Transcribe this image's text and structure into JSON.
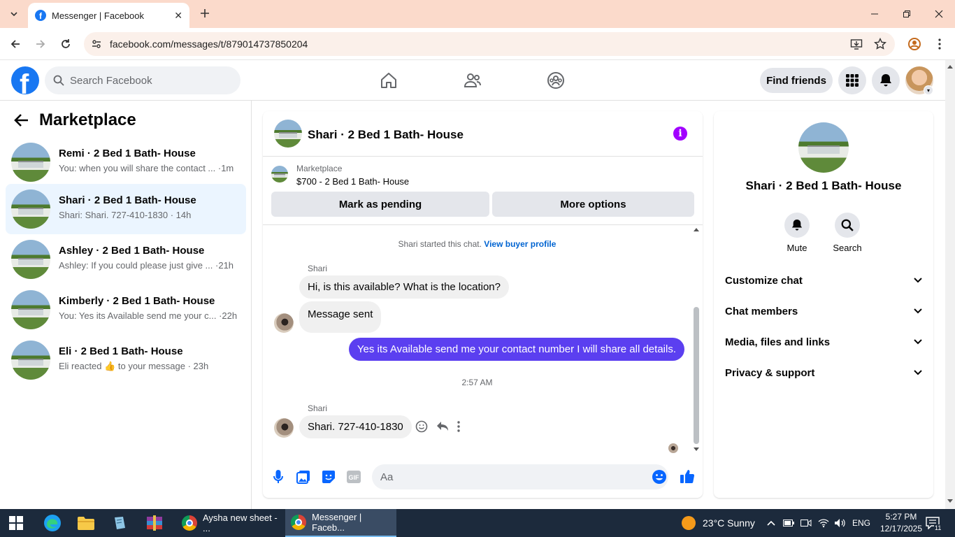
{
  "browser": {
    "tab_title": "Messenger | Facebook",
    "url": "facebook.com/messages/t/879014737850204"
  },
  "fb_nav": {
    "search_placeholder": "Search Facebook",
    "find_friends": "Find friends"
  },
  "sidebar": {
    "title": "Marketplace",
    "conversations": [
      {
        "name": "Remi · 2 Bed 1 Bath- House",
        "snippet": "You: when you will share the contact ... ·1m",
        "active": false
      },
      {
        "name": "Shari · 2 Bed 1 Bath- House",
        "snippet": "Shari: Shari. 727-410-1830 · 14h",
        "active": true
      },
      {
        "name": "Ashley · 2 Bed 1 Bath- House",
        "snippet": "Ashley: If you could please just give ... ·21h",
        "active": false
      },
      {
        "name": "Kimberly · 2 Bed 1 Bath- House",
        "snippet": "You: Yes its Available send me your c... ·22h",
        "active": false
      },
      {
        "name": "Eli · 2 Bed 1 Bath- House",
        "snippet_prefix": "Eli reacted",
        "snippet_suffix": "to your message · 23h",
        "active": false
      }
    ]
  },
  "chat": {
    "title": "Shari · 2 Bed 1 Bath- House",
    "marketplace_label": "Marketplace",
    "listing": "$700 - 2 Bed 1 Bath- House",
    "mark_pending": "Mark as pending",
    "more_options": "More options",
    "system_text": "Shari started this chat.",
    "system_link": "View buyer profile",
    "sender1": "Shari",
    "msg1": "Hi, is this available? What is the location?",
    "msg2": "Message sent",
    "msg_out": "Yes its Available send me your contact number I will share all details.",
    "timestamp": "2:57 AM",
    "sender2": "Shari",
    "msg3": "Shari. 727-410-1830",
    "composer_placeholder": "Aa"
  },
  "info_panel": {
    "name": "Shari · 2 Bed 1 Bath- House",
    "mute": "Mute",
    "search": "Search",
    "sections": [
      "Customize chat",
      "Chat members",
      "Media, files and links",
      "Privacy & support"
    ]
  },
  "taskbar": {
    "app1": "Aysha new sheet - ...",
    "app2": "Messenger | Faceb...",
    "weather": "23°C  Sunny",
    "lang": "ENG",
    "time": "5:27 PM",
    "date": "12/17/2025",
    "notif_count": "11"
  },
  "colors": {
    "fb_blue": "#1877f2",
    "outgoing_bubble": "#5b3ff0",
    "info_purple": "#a100ff",
    "active_conv": "#ebf5ff"
  }
}
